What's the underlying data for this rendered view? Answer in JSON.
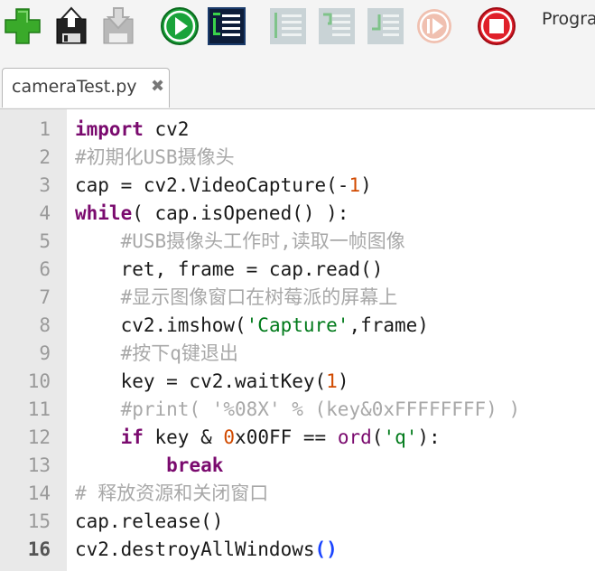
{
  "toolbar": {
    "buttons": [
      {
        "name": "new-button",
        "icon": "plus-icon",
        "color": "#3aaa2a",
        "disabled": false
      },
      {
        "name": "load-button",
        "icon": "load-file-icon",
        "color": "#222222",
        "disabled": false
      },
      {
        "name": "save-button",
        "icon": "save-file-icon",
        "color": "#b8b8b8",
        "disabled": true
      },
      {
        "name": "run-button",
        "icon": "play-icon",
        "color": "#1aa33a",
        "disabled": false
      },
      {
        "name": "debug-button",
        "icon": "debug-icon",
        "color": "#1a3a6a",
        "disabled": false
      },
      {
        "name": "step-over-button",
        "icon": "step-over-icon",
        "color": "#a8c8b0",
        "disabled": true
      },
      {
        "name": "step-into-button",
        "icon": "step-into-icon",
        "color": "#a8c8b0",
        "disabled": true
      },
      {
        "name": "step-out-button",
        "icon": "step-out-icon",
        "color": "#a8c8b0",
        "disabled": true
      },
      {
        "name": "resume-button",
        "icon": "resume-icon",
        "color": "#f0c0b0",
        "disabled": true
      },
      {
        "name": "stop-button",
        "icon": "stop-icon",
        "color": "#e0202a",
        "disabled": false
      }
    ],
    "program_label": "Progra"
  },
  "tabs": [
    {
      "label": "cameraTest.py",
      "close_glyph": "✖"
    }
  ],
  "editor": {
    "current_line": 16,
    "lines": [
      {
        "n": "1",
        "tokens": [
          {
            "t": "import",
            "k": "keyword"
          },
          {
            "t": " cv2",
            "k": "plain"
          }
        ]
      },
      {
        "n": "2",
        "tokens": [
          {
            "t": "#初期化USB摄像头",
            "k": "comment"
          }
        ]
      },
      {
        "n": "3",
        "tokens": [
          {
            "t": "cap = cv2.VideoCapture(-",
            "k": "plain"
          },
          {
            "t": "1",
            "k": "number"
          },
          {
            "t": ")",
            "k": "plain"
          }
        ]
      },
      {
        "n": "4",
        "tokens": [
          {
            "t": "while",
            "k": "keyword"
          },
          {
            "t": "( cap.isOpened() ):",
            "k": "plain"
          }
        ]
      },
      {
        "n": "5",
        "tokens": [
          {
            "t": "    ",
            "k": "plain"
          },
          {
            "t": "#USB摄像头工作时,读取一帧图像",
            "k": "comment"
          }
        ]
      },
      {
        "n": "6",
        "tokens": [
          {
            "t": "    ret, frame = cap.read()",
            "k": "plain"
          }
        ]
      },
      {
        "n": "7",
        "tokens": [
          {
            "t": "    ",
            "k": "plain"
          },
          {
            "t": "#显示图像窗口在树莓派的屏幕上",
            "k": "comment"
          }
        ]
      },
      {
        "n": "8",
        "tokens": [
          {
            "t": "    cv2.imshow(",
            "k": "plain"
          },
          {
            "t": "'Capture'",
            "k": "string"
          },
          {
            "t": ",frame)",
            "k": "plain"
          }
        ]
      },
      {
        "n": "9",
        "tokens": [
          {
            "t": "    ",
            "k": "plain"
          },
          {
            "t": "#按下q键退出",
            "k": "comment"
          }
        ]
      },
      {
        "n": "10",
        "tokens": [
          {
            "t": "    key = cv2.waitKey(",
            "k": "plain"
          },
          {
            "t": "1",
            "k": "number"
          },
          {
            "t": ")",
            "k": "plain"
          }
        ]
      },
      {
        "n": "11",
        "tokens": [
          {
            "t": "    ",
            "k": "plain"
          },
          {
            "t": "#print( '%08X' % (key&0xFFFFFFFF) )",
            "k": "comment"
          }
        ]
      },
      {
        "n": "12",
        "tokens": [
          {
            "t": "    ",
            "k": "plain"
          },
          {
            "t": "if",
            "k": "keyword"
          },
          {
            "t": " key & ",
            "k": "plain"
          },
          {
            "t": "0",
            "k": "number"
          },
          {
            "t": "x00FF == ",
            "k": "plain"
          },
          {
            "t": "ord",
            "k": "builtin"
          },
          {
            "t": "(",
            "k": "plain"
          },
          {
            "t": "'q'",
            "k": "string"
          },
          {
            "t": "):",
            "k": "plain"
          }
        ]
      },
      {
        "n": "13",
        "tokens": [
          {
            "t": "        ",
            "k": "plain"
          },
          {
            "t": "break",
            "k": "keyword"
          }
        ]
      },
      {
        "n": "14",
        "tokens": [
          {
            "t": "# 释放资源和关闭窗口",
            "k": "comment"
          }
        ]
      },
      {
        "n": "15",
        "tokens": [
          {
            "t": "cap.release()",
            "k": "plain"
          }
        ]
      },
      {
        "n": "16",
        "tokens": [
          {
            "t": "cv2.destroyAllWindows",
            "k": "plain"
          },
          {
            "t": "()",
            "k": "paren-match"
          }
        ]
      }
    ]
  }
}
